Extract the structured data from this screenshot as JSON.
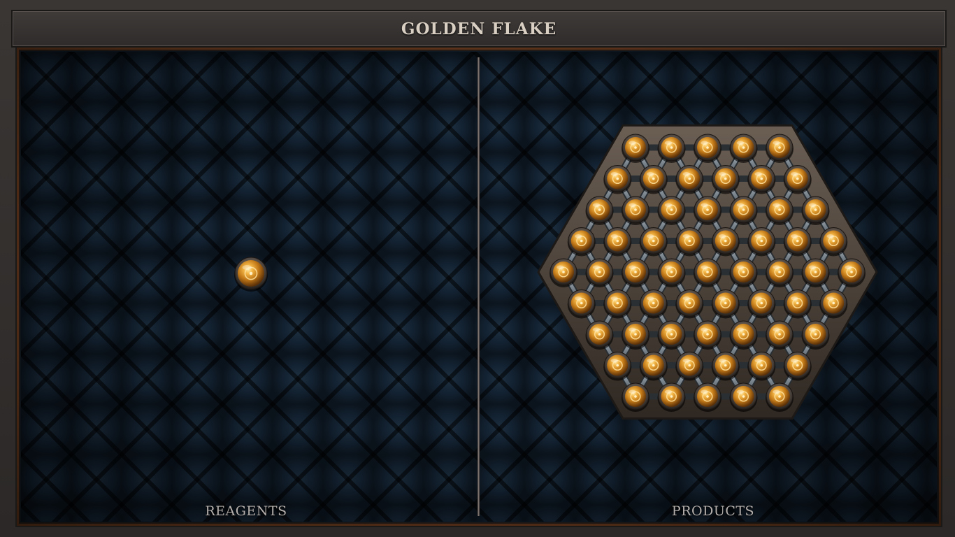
{
  "title": "GOLDEN FLAKE",
  "panels": {
    "reagents_label": "REAGENTS",
    "products_label": "PRODUCTS"
  },
  "reagents": {
    "atoms": [
      {
        "element": "gold",
        "count": 1
      }
    ]
  },
  "products": {
    "molecule": "golden flake",
    "shape": "hexagon",
    "rows": [
      5,
      6,
      7,
      8,
      9,
      8,
      7,
      6,
      5
    ],
    "atom_count": 61
  },
  "colors": {
    "gold": "#d18a1f",
    "frame": "#2e2b2a",
    "accent_trim": "#6b3b1e",
    "background": "#0f1a25",
    "text": "#d9cfc3"
  }
}
